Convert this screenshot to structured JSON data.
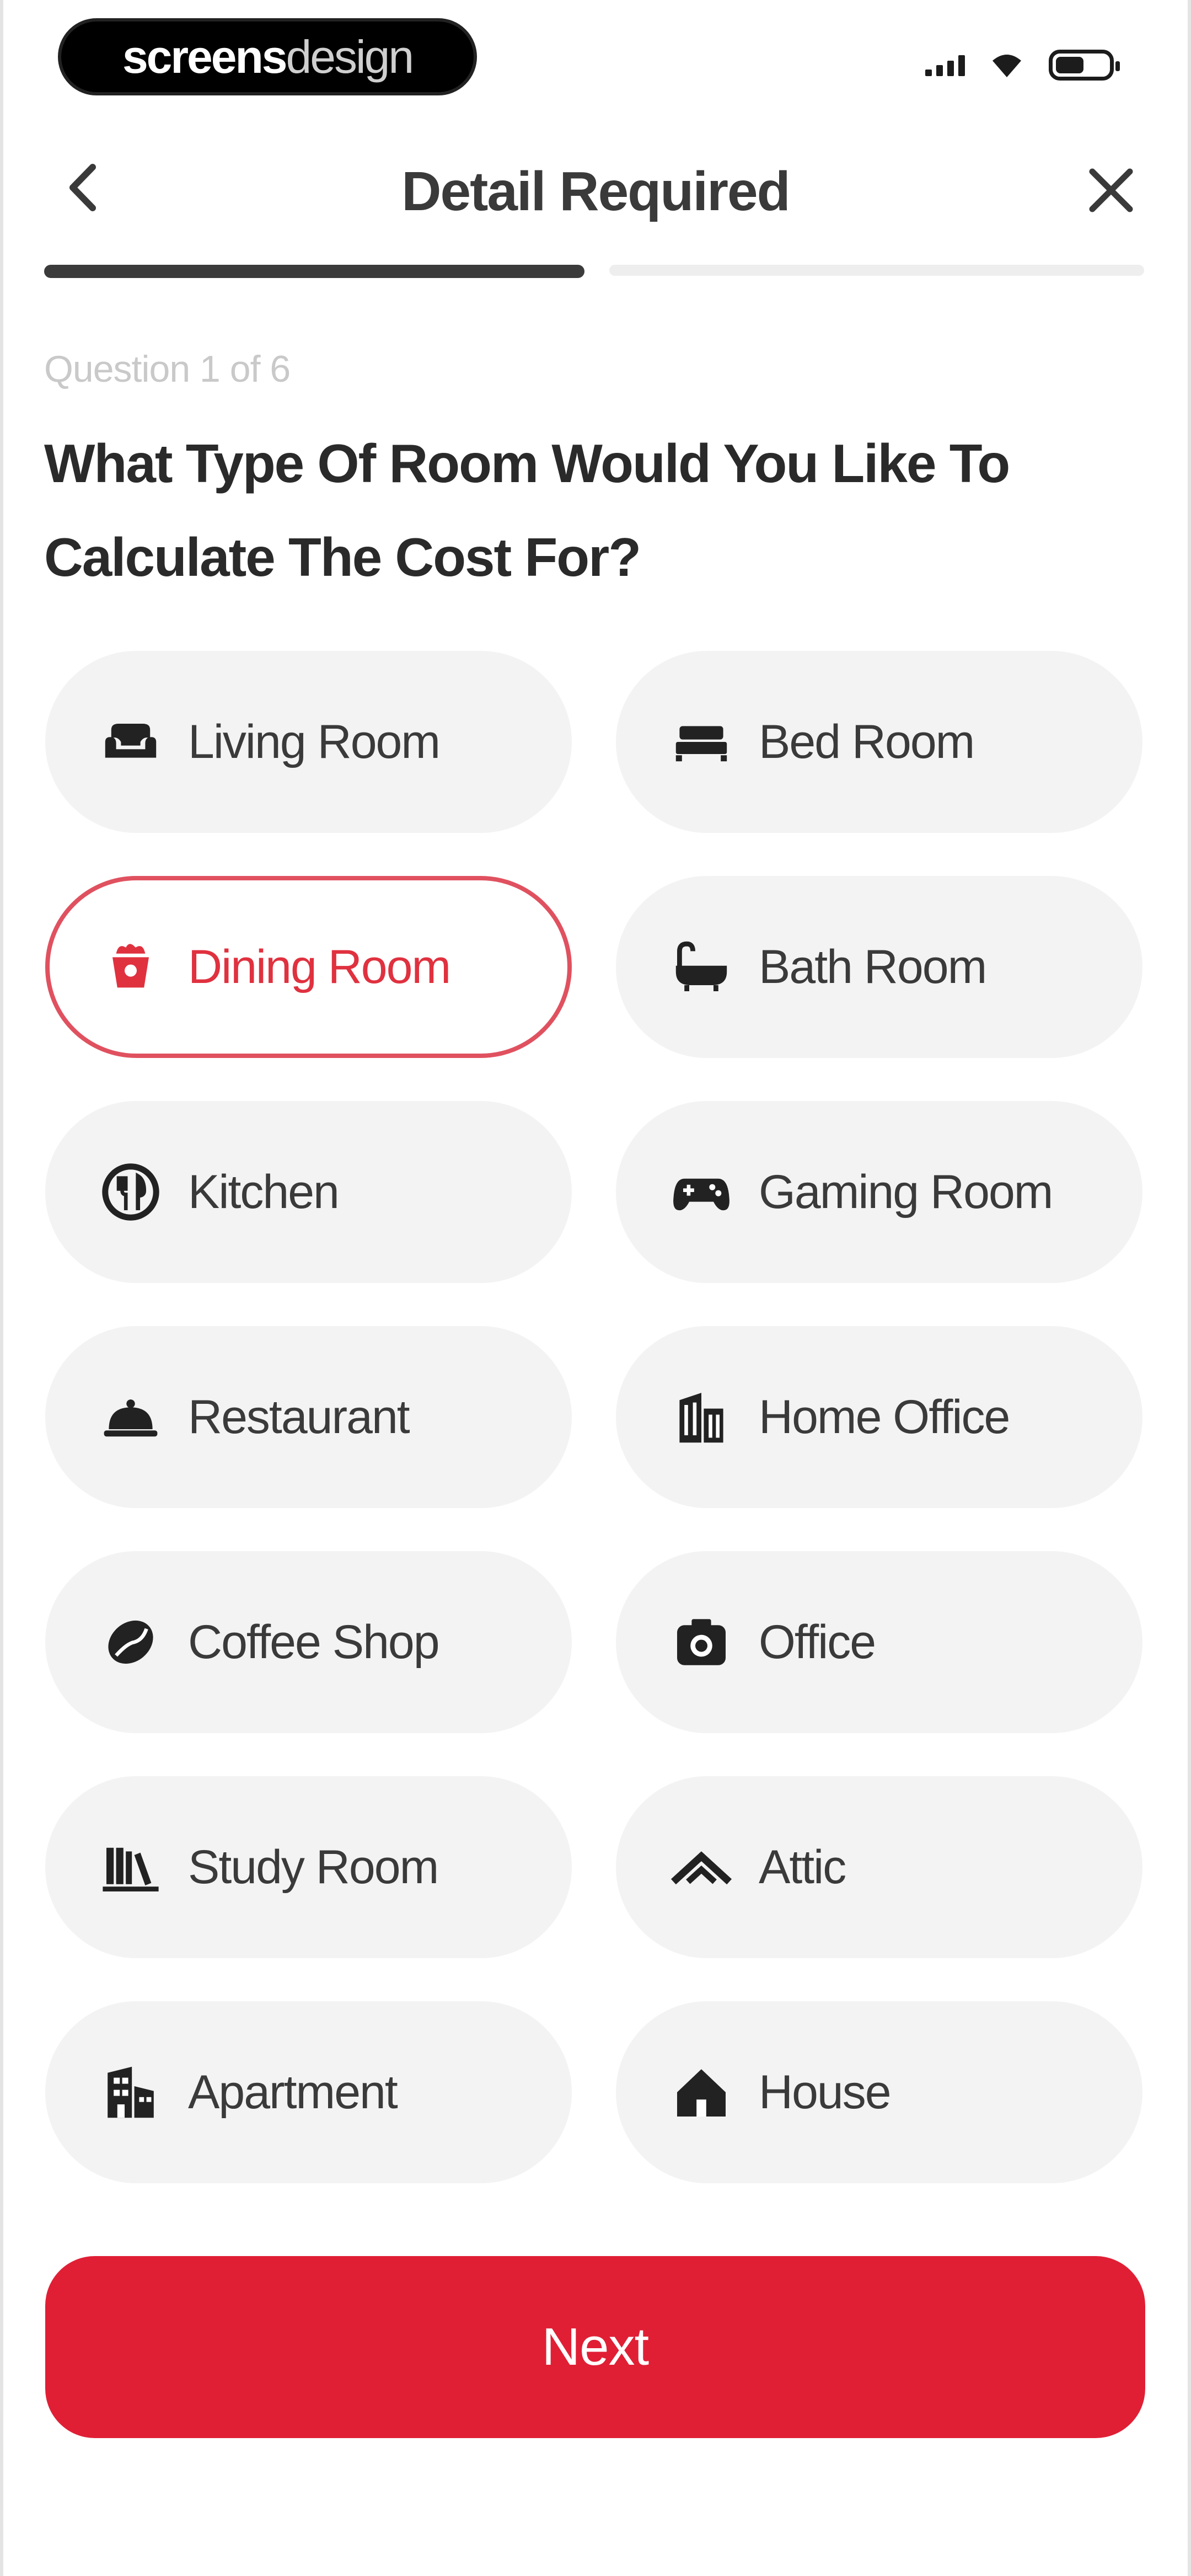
{
  "status_bar": {
    "brand_part1": "screens",
    "brand_part2": "design",
    "icons": [
      "signal-icon",
      "wifi-icon",
      "battery-icon"
    ]
  },
  "header": {
    "title": "Detail Required",
    "back_icon": "chevron-left-icon",
    "close_icon": "close-icon"
  },
  "progress": {
    "current_step": 1,
    "total_steps": 2
  },
  "question": {
    "counter": "Question 1 of 6",
    "text": "What Type Of Room Would You Like To Calculate The Cost For?"
  },
  "options": [
    {
      "label": "Living Room",
      "icon": "sofa-icon",
      "selected": false
    },
    {
      "label": "Bed Room",
      "icon": "bed-icon",
      "selected": false
    },
    {
      "label": "Dining Room",
      "icon": "dining-icon",
      "selected": true
    },
    {
      "label": "Bath Room",
      "icon": "bathtub-icon",
      "selected": false
    },
    {
      "label": "Kitchen",
      "icon": "cutlery-icon",
      "selected": false
    },
    {
      "label": "Gaming Room",
      "icon": "gamepad-icon",
      "selected": false
    },
    {
      "label": "Restaurant",
      "icon": "cloche-icon",
      "selected": false
    },
    {
      "label": "Home Office",
      "icon": "building-icon",
      "selected": false
    },
    {
      "label": "Coffee Shop",
      "icon": "coffee-bean-icon",
      "selected": false
    },
    {
      "label": "Office",
      "icon": "camera-icon",
      "selected": false
    },
    {
      "label": "Study Room",
      "icon": "books-icon",
      "selected": false
    },
    {
      "label": "Attic",
      "icon": "roof-icon",
      "selected": false
    },
    {
      "label": "Apartment",
      "icon": "apartment-icon",
      "selected": false
    },
    {
      "label": "House",
      "icon": "house-icon",
      "selected": false
    }
  ],
  "actions": {
    "next_label": "Next"
  },
  "colors": {
    "accent": "#e01f35",
    "selected_text": "#e0313f",
    "option_bg": "#f3f3f3"
  }
}
